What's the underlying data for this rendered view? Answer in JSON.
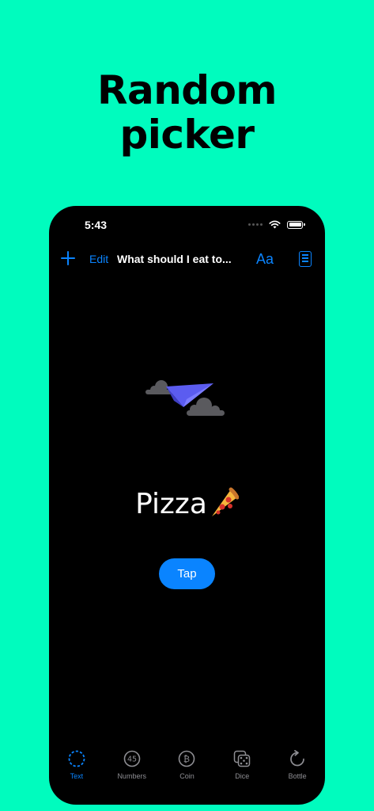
{
  "headline": {
    "line1": "Random",
    "line2": "picker"
  },
  "status_bar": {
    "time": "5:43"
  },
  "nav": {
    "edit_label": "Edit",
    "title": "What should I eat to...",
    "font_label": "Aa"
  },
  "result": {
    "text": "Pizza"
  },
  "tap_label": "Tap",
  "tabs": [
    {
      "label": "Text",
      "icon": "dashed-circle-icon",
      "active": true
    },
    {
      "label": "Numbers",
      "icon": "number-45-icon",
      "active": false
    },
    {
      "label": "Coin",
      "icon": "coin-icon",
      "active": false
    },
    {
      "label": "Dice",
      "icon": "dice-icon",
      "active": false
    },
    {
      "label": "Bottle",
      "icon": "rotate-arrow-icon",
      "active": false
    }
  ],
  "colors": {
    "background": "#00FCBE",
    "accent": "#0A84FF",
    "inactive": "#8E8E93"
  }
}
